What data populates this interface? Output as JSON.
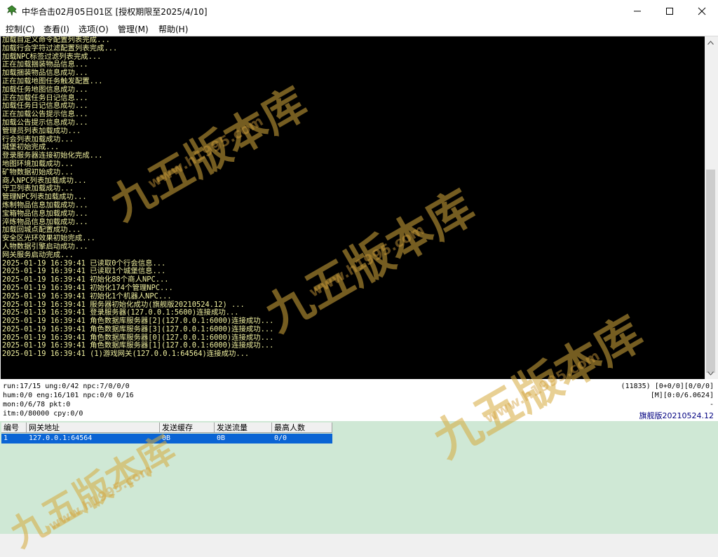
{
  "window": {
    "title": "中华合击02月05日01区 [授权期限至2025/4/10]",
    "minimize_glyph": "—",
    "maximize_glyph": "☐",
    "close_glyph": "✕"
  },
  "menu": [
    "控制(C)",
    "查看(I)",
    "选项(O)",
    "管理(M)",
    "帮助(H)"
  ],
  "console_lines": [
    "加载自定义命令配置列表完成...",
    "加载行会字符过滤配置列表完成...",
    "加载NPC标签过滤列表完成...",
    "正在加载捆装物品信息...",
    "加载捆装物品信息成功...",
    "正在加载地图任务触发配置...",
    "加载任务地图信息成功...",
    "正在加载任务日记信息...",
    "加载任务日记信息成功...",
    "正在加载公告提示信息...",
    "加载公告提示信息成功...",
    "管理员列表加载成功...",
    "行会列表加载成功...",
    "城堡初始完成...",
    "登录服务器连接初始化完成...",
    "地图环境加载成功...",
    "矿物数据初始成功...",
    "商人NPC列表加载成功...",
    "守卫列表加载成功...",
    "管理NPC列表加载成功...",
    "炼制物品信息加载成功...",
    "宝箱物品信息加载成功...",
    "淬炼物品信息加载成功...",
    "加载回城点配置成功...",
    "安全区光环效果初始完成...",
    "人物数据引擎启动成功...",
    "网关服务启动完成...",
    "2025-01-19 16:39:41 已读取0个行会信息...",
    "2025-01-19 16:39:41 已读取1个城堡信息...",
    "2025-01-19 16:39:41 初始化88个商人NPC...",
    "2025-01-19 16:39:41 初始化174个管理NPC...",
    "2025-01-19 16:39:41 初始化1个机器人NPC...",
    "2025-01-19 16:39:41 服务器初始化成功(旗舰版20210524.12) ...",
    "2025-01-19 16:39:41 登录服务器(127.0.0.1:5600)连接成功...",
    "2025-01-19 16:39:41 角色数据库服务器[2](127.0.0.1:6000)连接成功...",
    "2025-01-19 16:39:41 角色数据库服务器[3](127.0.0.1:6000)连接成功...",
    "2025-01-19 16:39:41 角色数据库服务器[0](127.0.0.1:6000)连接成功...",
    "2025-01-19 16:39:41 角色数据库服务器[1](127.0.0.1:6000)连接成功...",
    "2025-01-19 16:39:41 (1)游戏网关(127.0.0.1:64564)连接成功..."
  ],
  "status": {
    "left": [
      "run:17/15 ung:0/42 npc:7/0/0/0",
      "hum:0/0 eng:16/101 npc:0/0 0/16",
      "mon:0/6/78 pkt:0",
      "itm:0/80000 cpy:0/0"
    ],
    "right": [
      "(11835) [0+0/0][0/0/0]",
      "[M][0:0/6.0624]",
      "-",
      "旗舰版20210524.12"
    ]
  },
  "gateway_table": {
    "headers": [
      "编号",
      "网关地址",
      "发送缓存",
      "发送流量",
      "最高人数"
    ],
    "rows": [
      [
        "1",
        "127.0.0.1:64564",
        "0B",
        "0B",
        "0/0"
      ]
    ]
  },
  "watermark": {
    "text": "九五版本库",
    "url": "www.h1995.com"
  }
}
